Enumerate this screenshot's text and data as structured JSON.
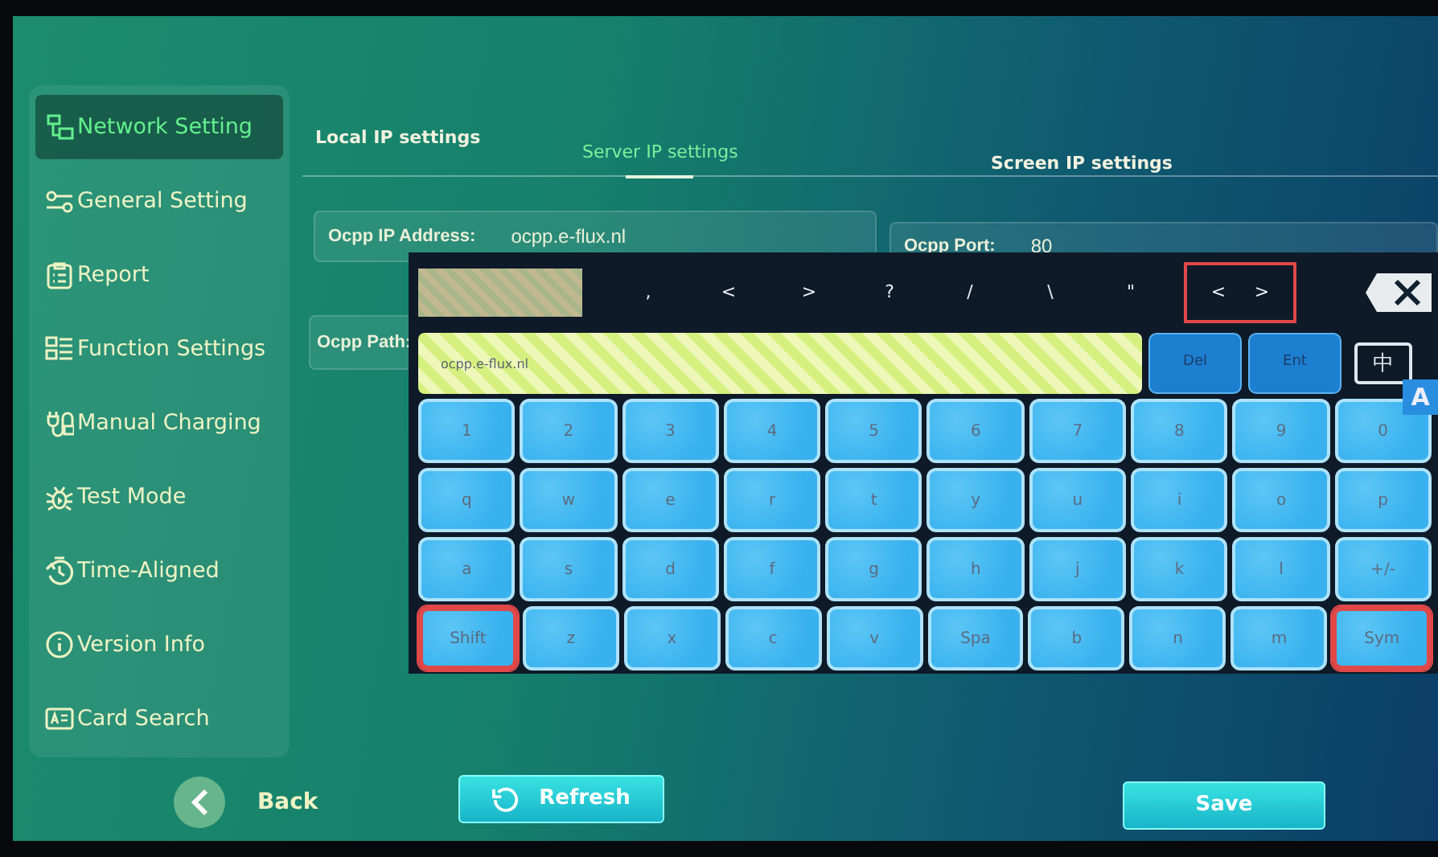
{
  "sidebar": {
    "items": [
      {
        "label": "Network Setting",
        "selected": true
      },
      {
        "label": "General Setting",
        "selected": false
      },
      {
        "label": "Report",
        "selected": false
      },
      {
        "label": "Function Settings",
        "selected": false
      },
      {
        "label": "Manual Charging",
        "selected": false
      },
      {
        "label": "Test Mode",
        "selected": false
      },
      {
        "label": "Time-Aligned",
        "selected": false
      },
      {
        "label": "Version Info",
        "selected": false
      },
      {
        "label": "Card Search",
        "selected": false
      }
    ]
  },
  "tabs": [
    {
      "label": "Local IP settings",
      "selected": false
    },
    {
      "label": "Server IP settings",
      "selected": true
    },
    {
      "label": "Screen IP settings",
      "selected": false
    }
  ],
  "fields": [
    {
      "label": "Ocpp IP Address:",
      "value": "ocpp.e-flux.nl"
    },
    {
      "label": "Ocpp Port:",
      "value": "80"
    },
    {
      "label": "Ocpp Path:"
    }
  ],
  "keyboard": {
    "symbols": [
      ",",
      "<",
      ">",
      "?",
      "/",
      "\\",
      "\""
    ],
    "cursor_keys": {
      "keys": [
        "<",
        ">"
      ],
      "highlighted": true
    },
    "input": {
      "value": "ocpp.e-flux.nl"
    },
    "actions": [
      "Del",
      "Ent"
    ],
    "ime": "中",
    "case_indicator": "A",
    "rows": [
      [
        {
          "label": "1",
          "highlighted": false
        },
        {
          "label": "2",
          "highlighted": false
        },
        {
          "label": "3",
          "highlighted": false
        },
        {
          "label": "4",
          "highlighted": false
        },
        {
          "label": "5",
          "highlighted": false
        },
        {
          "label": "6",
          "highlighted": false
        },
        {
          "label": "7",
          "highlighted": false
        },
        {
          "label": "8",
          "highlighted": false
        },
        {
          "label": "9",
          "highlighted": false
        },
        {
          "label": "0",
          "highlighted": false
        }
      ],
      [
        {
          "label": "q",
          "highlighted": false
        },
        {
          "label": "w",
          "highlighted": false
        },
        {
          "label": "e",
          "highlighted": false
        },
        {
          "label": "r",
          "highlighted": false
        },
        {
          "label": "t",
          "highlighted": false
        },
        {
          "label": "y",
          "highlighted": false
        },
        {
          "label": "u",
          "highlighted": false
        },
        {
          "label": "i",
          "highlighted": false
        },
        {
          "label": "o",
          "highlighted": false
        },
        {
          "label": "p",
          "highlighted": false
        }
      ],
      [
        {
          "label": "a",
          "highlighted": false
        },
        {
          "label": "s",
          "highlighted": false
        },
        {
          "label": "d",
          "highlighted": false
        },
        {
          "label": "f",
          "highlighted": false
        },
        {
          "label": "g",
          "highlighted": false
        },
        {
          "label": "h",
          "highlighted": false
        },
        {
          "label": "j",
          "highlighted": false
        },
        {
          "label": "k",
          "highlighted": false
        },
        {
          "label": "l",
          "highlighted": false
        },
        {
          "label": "+/-",
          "highlighted": false
        }
      ],
      [
        {
          "label": "Shift",
          "highlighted": true
        },
        {
          "label": "z",
          "highlighted": false
        },
        {
          "label": "x",
          "highlighted": false
        },
        {
          "label": "c",
          "highlighted": false
        },
        {
          "label": "v",
          "highlighted": false
        },
        {
          "label": "Spa",
          "highlighted": false
        },
        {
          "label": "b",
          "highlighted": false
        },
        {
          "label": "n",
          "highlighted": false
        },
        {
          "label": "m",
          "highlighted": false
        },
        {
          "label": "Sym",
          "highlighted": true
        }
      ]
    ]
  },
  "footer": {
    "back": "Back",
    "refresh": "Refresh",
    "save": "Save"
  }
}
